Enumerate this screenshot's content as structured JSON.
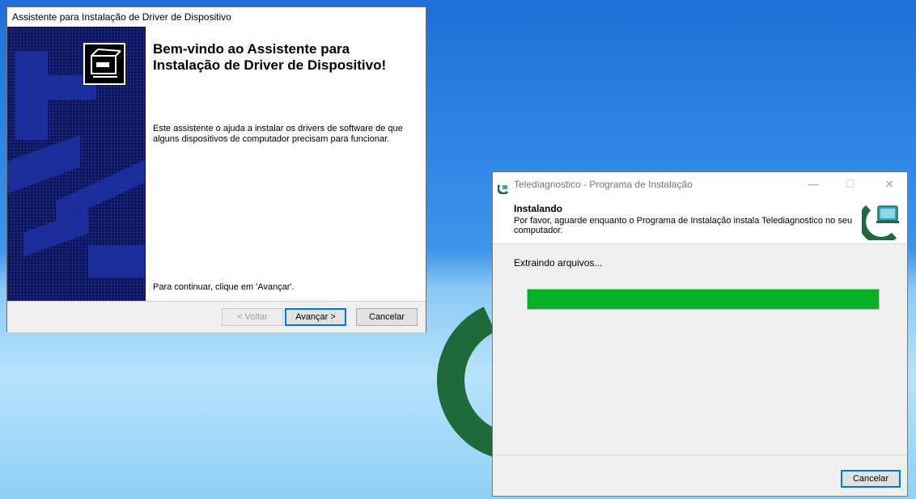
{
  "wizard": {
    "title": "Assistente para Instalação de Driver de Dispositivo",
    "heading": "Bem-vindo ao Assistente para Instalação de Driver de Dispositivo!",
    "description": "Este assistente o ajuda a instalar os drivers de software de que alguns dispositivos de computador precisam para funcionar.",
    "continue_text": "Para continuar, clique em 'Avançar'.",
    "back_label": "< Voltar",
    "next_label": "Avançar >",
    "cancel_label": "Cancelar"
  },
  "installer": {
    "title": "Telediagnostico - Programa de Instalação",
    "header_title": "Instalando",
    "header_desc": "Por favor, aguarde enquanto o Programa de Instalação instala Telediagnostico no seu computador.",
    "status": "Extraindo arquivos...",
    "progress_percent": 100,
    "cancel_label": "Cancelar",
    "minimize_glyph": "—",
    "maximize_glyph": "☐",
    "close_glyph": "✕"
  },
  "colors": {
    "progress": "#06b025",
    "brand_green": "#1f6a3a",
    "wizard_panel": "#0b1460"
  }
}
